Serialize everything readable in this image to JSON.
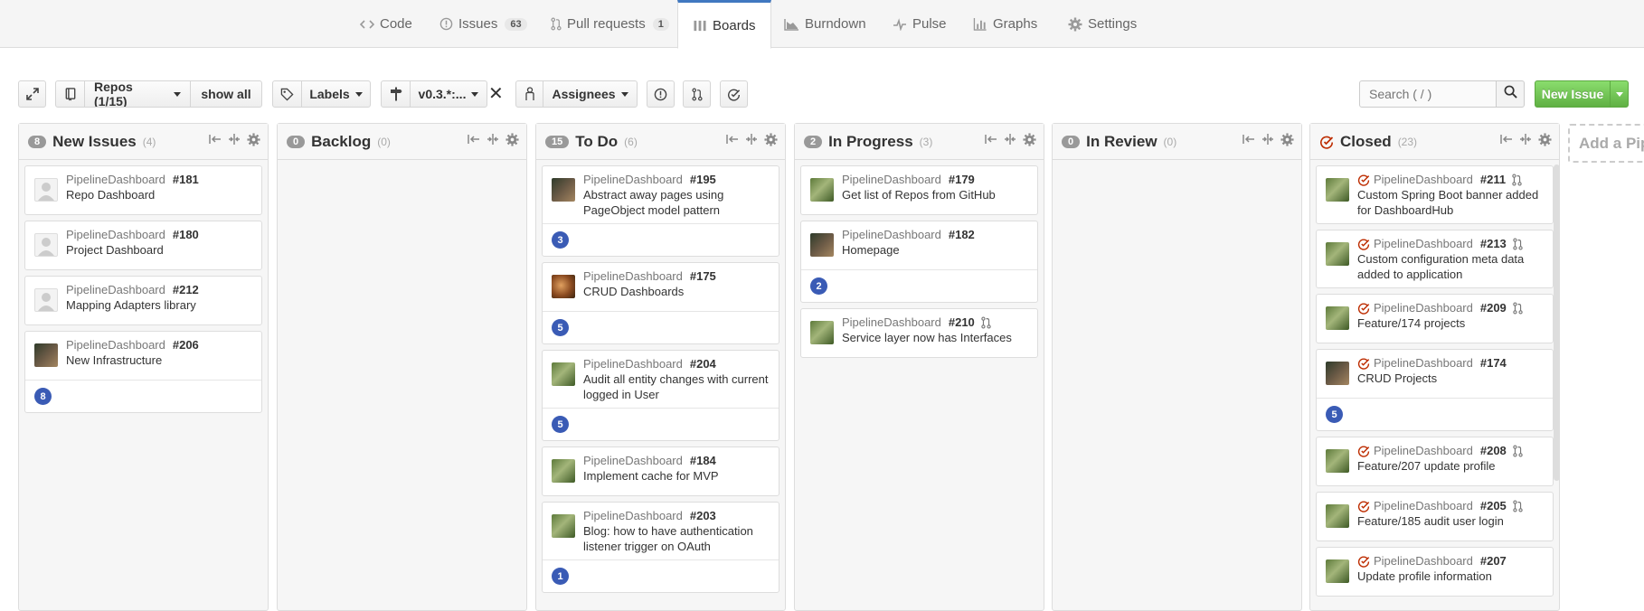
{
  "nav": {
    "tabs": [
      {
        "label": "Code",
        "icon": "code-icon"
      },
      {
        "label": "Issues",
        "icon": "issue-opened-icon",
        "count": "63"
      },
      {
        "label": "Pull requests",
        "icon": "git-pull-request-icon",
        "count": "1"
      },
      {
        "label": "Boards",
        "icon": "board-icon",
        "active": true
      },
      {
        "label": "Burndown",
        "icon": "burndown-icon"
      },
      {
        "label": "Pulse",
        "icon": "pulse-icon"
      },
      {
        "label": "Graphs",
        "icon": "graph-icon"
      },
      {
        "label": "Settings",
        "icon": "gear-icon"
      }
    ]
  },
  "toolbar": {
    "repos_label": "Repos (1/15)",
    "show_all_label": "show all",
    "labels_label": "Labels",
    "milestone_label": "v0.3.*:...",
    "clear_label": "✕",
    "assignees_label": "Assignees",
    "search_placeholder": "Search ( / )",
    "new_issue_label": "New Issue"
  },
  "board": {
    "add_pipeline_label": "Add a Pip",
    "pipelines": [
      {
        "name": "New Issues",
        "badge": "8",
        "total": "(4)",
        "cards": [
          {
            "repo": "PipelineDashboard",
            "number": "#181",
            "title": "Repo Dashboard",
            "avatar": "blank"
          },
          {
            "repo": "PipelineDashboard",
            "number": "#180",
            "title": "Project Dashboard",
            "avatar": "blank"
          },
          {
            "repo": "PipelineDashboard",
            "number": "#212",
            "title": "Mapping Adapters library",
            "avatar": "blank"
          },
          {
            "repo": "PipelineDashboard",
            "number": "#206",
            "title": "New Infrastructure",
            "avatar": "photo2",
            "estimate": "8"
          }
        ]
      },
      {
        "name": "Backlog",
        "badge": "0",
        "total": "(0)",
        "cards": []
      },
      {
        "name": "To Do",
        "badge": "15",
        "total": "(6)",
        "cards": [
          {
            "repo": "PipelineDashboard",
            "number": "#195",
            "title": "Abstract away pages using PageObject model pattern",
            "avatar": "photo2",
            "estimate": "3"
          },
          {
            "repo": "PipelineDashboard",
            "number": "#175",
            "title": "CRUD Dashboards",
            "avatar": "photo3",
            "estimate": "5"
          },
          {
            "repo": "PipelineDashboard",
            "number": "#204",
            "title": "Audit all entity changes with current logged in User",
            "avatar": "photo",
            "estimate": "5"
          },
          {
            "repo": "PipelineDashboard",
            "number": "#184",
            "title": "Implement cache for MVP",
            "avatar": "photo"
          },
          {
            "repo": "PipelineDashboard",
            "number": "#203",
            "title": "Blog: how to have authentication listener trigger on OAuth",
            "avatar": "photo",
            "estimate": "1"
          }
        ]
      },
      {
        "name": "In Progress",
        "badge": "2",
        "total": "(3)",
        "cards": [
          {
            "repo": "PipelineDashboard",
            "number": "#179",
            "title": "Get list of Repos from GitHub",
            "avatar": "photo"
          },
          {
            "repo": "PipelineDashboard",
            "number": "#182",
            "title": "Homepage",
            "avatar": "photo2",
            "estimate": "2"
          },
          {
            "repo": "PipelineDashboard",
            "number": "#210",
            "title": "Service layer now has Interfaces",
            "avatar": "photo",
            "pr": true
          }
        ]
      },
      {
        "name": "In Review",
        "badge": "0",
        "total": "(0)",
        "cards": []
      },
      {
        "name": "Closed",
        "badge": "",
        "total": "(23)",
        "closed": true,
        "cards": [
          {
            "repo": "PipelineDashboard",
            "number": "#211",
            "title": "Custom Spring Boot banner added for DashboardHub",
            "avatar": "photo",
            "pr": true,
            "closed": true
          },
          {
            "repo": "PipelineDashboard",
            "number": "#213",
            "title": "Custom configuration meta data added to application",
            "avatar": "photo",
            "pr": true,
            "closed": true
          },
          {
            "repo": "PipelineDashboard",
            "number": "#209",
            "title": "Feature/174 projects",
            "avatar": "photo",
            "pr": true,
            "closed": true
          },
          {
            "repo": "PipelineDashboard",
            "number": "#174",
            "title": "CRUD Projects",
            "avatar": "photo2",
            "closed": true,
            "estimate": "5"
          },
          {
            "repo": "PipelineDashboard",
            "number": "#208",
            "title": "Feature/207 update profile",
            "avatar": "photo",
            "pr": true,
            "closed": true
          },
          {
            "repo": "PipelineDashboard",
            "number": "#205",
            "title": "Feature/185 audit user login",
            "avatar": "photo",
            "pr": true,
            "closed": true
          },
          {
            "repo": "PipelineDashboard",
            "number": "#207",
            "title": "Update profile information",
            "avatar": "photo",
            "closed": true
          }
        ]
      }
    ]
  },
  "colors": {
    "accent": "#4078c0",
    "new_issue_green": "#60b044",
    "estimate_blue": "#3a5bb5",
    "closed_red": "#bd2c00"
  }
}
